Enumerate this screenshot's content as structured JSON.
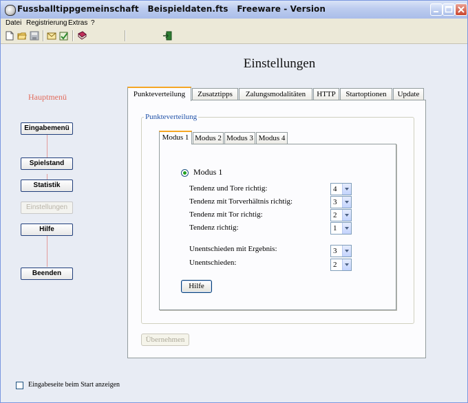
{
  "window": {
    "title_parts": [
      "Fussballtippgemeinschaft",
      "Beispieldaten.fts",
      "Freeware - Version"
    ],
    "controls": {
      "minimize": "minimize-icon",
      "maximize": "maximize-icon",
      "close": "close-icon"
    }
  },
  "menu": [
    "Datei",
    "Registrierung",
    "Extras",
    "?"
  ],
  "toolbar": [
    "new-file-icon",
    "open-folder-icon",
    "save-icon",
    "mail-icon",
    "check-document-icon",
    "book-icon",
    "exit-door-icon"
  ],
  "page": {
    "heading": "Einstellungen"
  },
  "sidebar": {
    "title": "Hauptmenü",
    "buttons": [
      {
        "label": "Eingabemenü",
        "enabled": true
      },
      {
        "label": "Spielstand",
        "enabled": true
      },
      {
        "label": "Statistik",
        "enabled": true
      },
      {
        "label": "Einstellungen",
        "enabled": false
      },
      {
        "label": "Hilfe",
        "enabled": true
      },
      {
        "label": "Beenden",
        "enabled": true
      }
    ]
  },
  "startup_checkbox": {
    "label": "Eingabeseite beim Start anzeigen",
    "checked": false
  },
  "tabs": [
    "Punkteverteilung",
    "Zusatztipps",
    "Zalungsmodalitäten",
    "HTTP",
    "Startoptionen",
    "Update"
  ],
  "active_tab": "Punkteverteilung",
  "group": {
    "title": "Punkteverteilung",
    "inner_tabs": [
      "Modus 1",
      "Modus 2",
      "Modus 3",
      "Modus 4"
    ],
    "active_inner_tab": "Modus 1",
    "radio_label": "Modus 1",
    "rows": [
      {
        "label": "Tendenz und Tore richtig:",
        "value": "4"
      },
      {
        "label": "Tendenz mit Torverhältnis richtig:",
        "value": "3"
      },
      {
        "label": "Tendenz mit Tor richtig:",
        "value": "2"
      },
      {
        "label": "Tendenz richtig:",
        "value": "1"
      },
      {
        "label": "Unentschieden mit Ergebnis:",
        "value": "3"
      },
      {
        "label": "Unentschieden:",
        "value": "2"
      }
    ],
    "help_button": "Hilfe"
  },
  "apply_button": "Übernehmen",
  "colors": {
    "title_bar": "#bcccef",
    "active_tab_accent": "#f5a623",
    "hauptmenu": "#e26b5b",
    "group_title": "#1f51a8",
    "radio_dot": "#21a121"
  }
}
